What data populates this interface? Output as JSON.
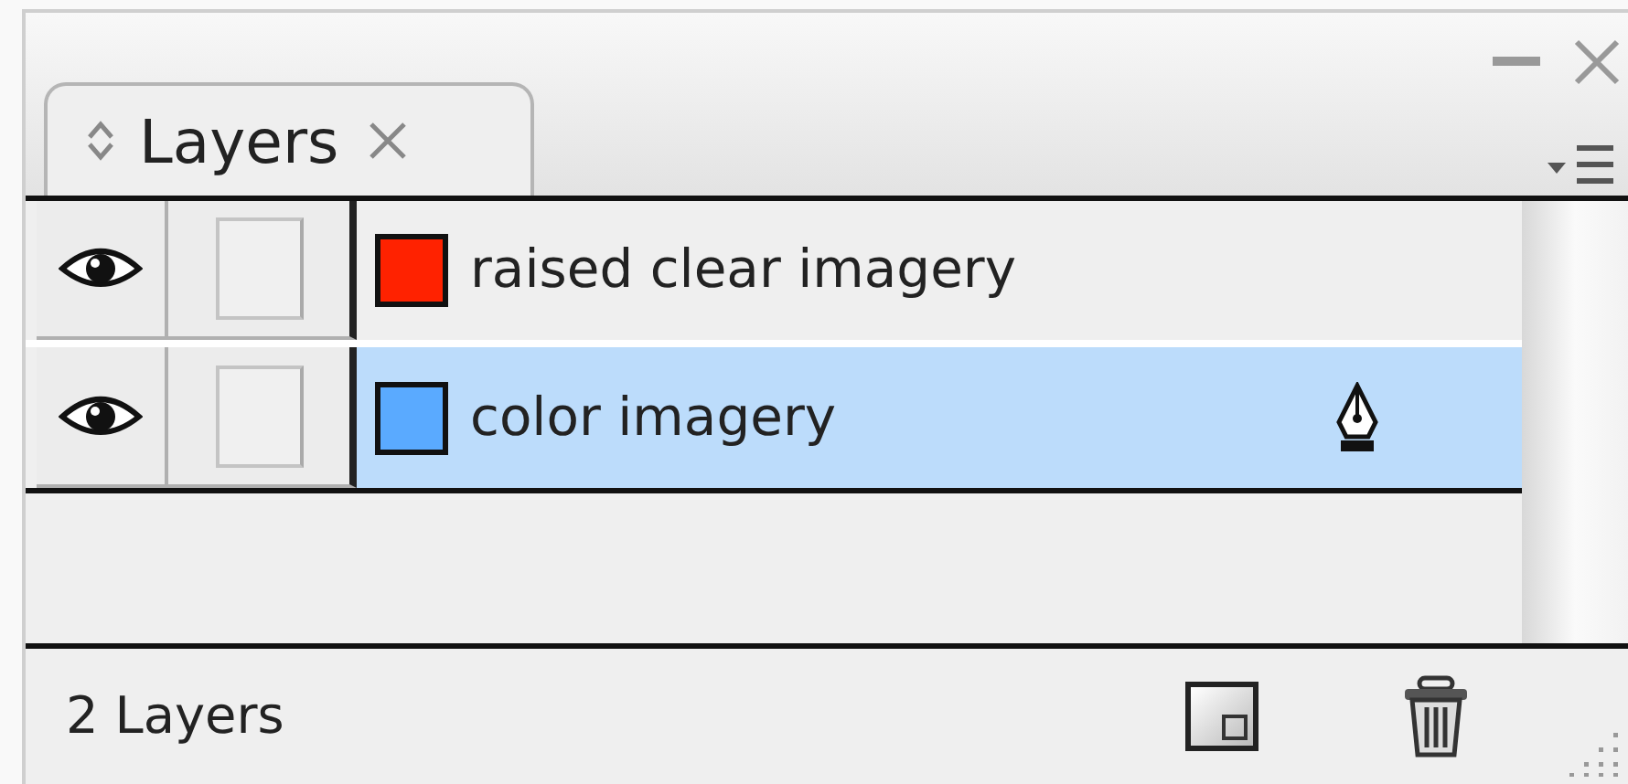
{
  "panel": {
    "tab": {
      "label": "Layers"
    }
  },
  "layers": [
    {
      "name": "raised clear imagery",
      "color": "#ff2200",
      "visible": true,
      "selected": false
    },
    {
      "name": "color imagery",
      "color": "#5aaaff",
      "visible": true,
      "selected": true
    }
  ],
  "status_bar": {
    "count": "2 Layers"
  }
}
